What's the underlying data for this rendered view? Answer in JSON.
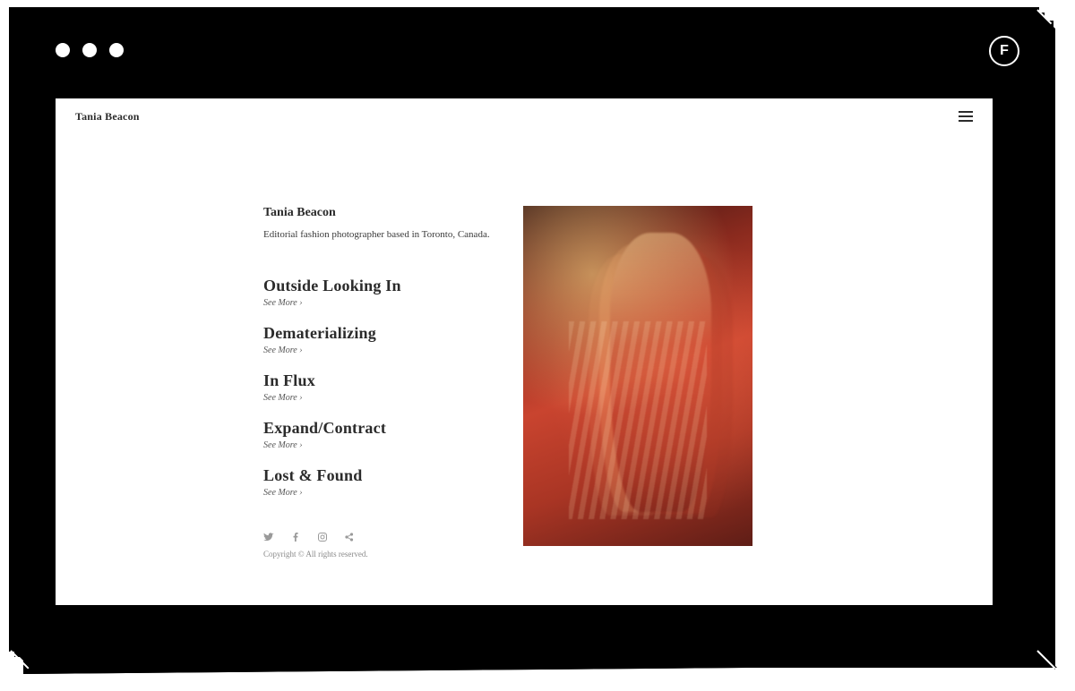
{
  "frame": {
    "badge_letter": "F"
  },
  "header": {
    "brand": "Tania Beacon"
  },
  "intro": {
    "name": "Tania Beacon",
    "tagline": "Editorial fashion photographer based in Toronto, Canada."
  },
  "see_more_label": "See More ›",
  "projects": [
    {
      "title": "Outside Looking In"
    },
    {
      "title": "Dematerializing"
    },
    {
      "title": "In Flux"
    },
    {
      "title": "Expand/Contract"
    },
    {
      "title": "Lost & Found"
    }
  ],
  "social": {
    "twitter": "twitter-icon",
    "facebook": "facebook-icon",
    "instagram": "instagram-icon",
    "share": "share-icon"
  },
  "footer": {
    "copyright": "Copyright © All rights reserved."
  }
}
